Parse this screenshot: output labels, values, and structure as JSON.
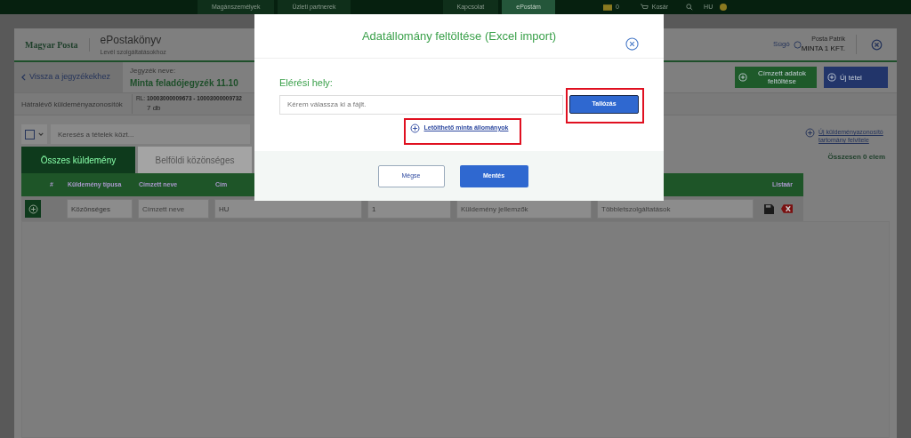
{
  "top_nav": {
    "items": [
      {
        "label": "Magánszemélyek",
        "selected": false
      },
      {
        "label": "Üzleti partnerek",
        "selected": false
      },
      {
        "label": "Kapcsolat",
        "selected": false
      },
      {
        "label": "ePostám",
        "selected": true
      }
    ],
    "messages": "0",
    "cart": "Kosár",
    "language": "HU"
  },
  "header": {
    "logo": "Magyar Posta",
    "app_title": "ePostakönyv",
    "app_subtitle": "Levél szolgáltatásokhoz",
    "help": "Súgó",
    "user_name": "Posta Patrik",
    "company": "MINTA 1 KFT."
  },
  "list_bar": {
    "back": "Vissza a jegyzékekhez",
    "name_label": "Jegyzék neve:",
    "name": "Minta feladójegyzék 11.10",
    "buttons": [
      {
        "kind": "upload",
        "label": "Címzett adatok feltöltése"
      },
      {
        "kind": "new",
        "label": "Új tétel"
      }
    ]
  },
  "remaining": {
    "label": "Hátralévő küldeményazonosítók",
    "range_prefix": "RL:",
    "range": "10003000009673 - 10003000009732",
    "count": "7 db"
  },
  "toolbar": {
    "select_all_checked": false,
    "search_placeholder": "Keresés a tételek közt...",
    "new_range_link": "Új küldeményazonosító tartomány felvitele",
    "total": "Összesen 0 elem"
  },
  "tabs": [
    {
      "label": "Összes küldemény",
      "selected": true
    },
    {
      "label": "Belföldi közönséges",
      "selected": false
    }
  ],
  "table": {
    "columns": [
      "#",
      "Küldemény típusa",
      "Címzett neve",
      "Cím",
      "Listaár"
    ],
    "row_fields": [
      {
        "value": "Közönséges"
      },
      {
        "placeholder": "Címzett neve"
      },
      {
        "value": "HU"
      },
      {
        "value": "1"
      },
      {
        "placeholder": "Küldemény jellemzők"
      },
      {
        "placeholder": "Többletszolgáltatások"
      }
    ]
  },
  "modal": {
    "title": "Adatállomány feltöltése (Excel import)",
    "field_label": "Elérési hely:",
    "field_placeholder": "Kérem válassza ki a fájlt.",
    "browse": "Tallózás",
    "sample_link": "Letölthető minta állományok",
    "cancel": "Mégse",
    "save": "Mentés"
  }
}
